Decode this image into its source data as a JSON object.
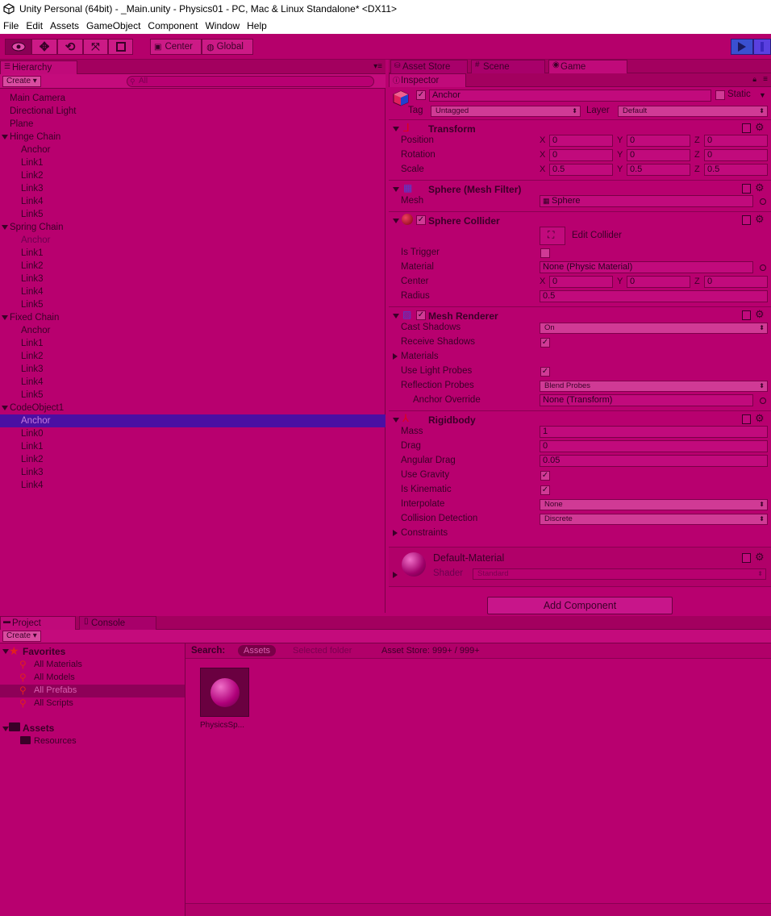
{
  "window_title": "Unity Personal (64bit) - _Main.unity - Physics01 - PC, Mac & Linux Standalone* <DX11>",
  "menu": [
    "File",
    "Edit",
    "Assets",
    "GameObject",
    "Component",
    "Window",
    "Help"
  ],
  "toolbar": {
    "center_label": "Center",
    "global_label": "Global"
  },
  "hierarchy": {
    "tab": "Hierarchy",
    "create": "Create",
    "search_placeholder": "All",
    "items": [
      {
        "label": "Main Camera"
      },
      {
        "label": "Directional Light"
      },
      {
        "label": "Plane"
      },
      {
        "label": "Hinge Chain"
      },
      {
        "label": "Anchor"
      },
      {
        "label": "Link1"
      },
      {
        "label": "Link2"
      },
      {
        "label": "Link3"
      },
      {
        "label": "Link4"
      },
      {
        "label": "Link5"
      },
      {
        "label": "Spring Chain"
      },
      {
        "label": "Anchor"
      },
      {
        "label": "Link1"
      },
      {
        "label": "Link2"
      },
      {
        "label": "Link3"
      },
      {
        "label": "Link4"
      },
      {
        "label": "Link5"
      },
      {
        "label": "Fixed Chain"
      },
      {
        "label": "Anchor"
      },
      {
        "label": "Link1"
      },
      {
        "label": "Link2"
      },
      {
        "label": "Link3"
      },
      {
        "label": "Link4"
      },
      {
        "label": "Link5"
      },
      {
        "label": "CodeObject1"
      },
      {
        "label": "Anchor"
      },
      {
        "label": "Link0"
      },
      {
        "label": "Link1"
      },
      {
        "label": "Link2"
      },
      {
        "label": "Link3"
      },
      {
        "label": "Link4"
      }
    ]
  },
  "top_tabs": {
    "asset_store": "Asset Store",
    "scene": "Scene",
    "game": "Game"
  },
  "inspector": {
    "tab": "Inspector",
    "object_name": "Anchor",
    "static_label": "Static",
    "tag_label": "Tag",
    "tag_value": "Untagged",
    "layer_label": "Layer",
    "layer_value": "Default",
    "transform": {
      "title": "Transform",
      "position_label": "Position",
      "position": [
        "0",
        "0",
        "0"
      ],
      "rotation_label": "Rotation",
      "rotation": [
        "0",
        "0",
        "0"
      ],
      "scale_label": "Scale",
      "scale": [
        "0.5",
        "0.5",
        "0.5"
      ],
      "axes": [
        "X",
        "Y",
        "Z"
      ]
    },
    "mesh_filter": {
      "title": "Sphere (Mesh Filter)",
      "mesh_label": "Mesh",
      "mesh_value": "Sphere"
    },
    "sphere_collider": {
      "title": "Sphere Collider",
      "edit_label": "Edit Collider",
      "is_trigger_label": "Is Trigger",
      "material_label": "Material",
      "material_value": "None (Physic Material)",
      "center_label": "Center",
      "center": [
        "0",
        "0",
        "0"
      ],
      "radius_label": "Radius",
      "radius_value": "0.5"
    },
    "mesh_renderer": {
      "title": "Mesh Renderer",
      "cast_shadows_label": "Cast Shadows",
      "cast_shadows_value": "On",
      "receive_shadows_label": "Receive Shadows",
      "materials_label": "Materials",
      "light_probes_label": "Use Light Probes",
      "reflection_label": "Reflection Probes",
      "reflection_value": "Blend Probes",
      "anchor_override_label": "Anchor Override",
      "anchor_override_value": "None (Transform)"
    },
    "rigidbody": {
      "title": "Rigidbody",
      "mass_label": "Mass",
      "mass_value": "1",
      "drag_label": "Drag",
      "drag_value": "0",
      "angular_drag_label": "Angular Drag",
      "angular_drag_value": "0.05",
      "use_gravity_label": "Use Gravity",
      "is_kinematic_label": "Is Kinematic",
      "interpolate_label": "Interpolate",
      "interpolate_value": "None",
      "collision_label": "Collision Detection",
      "collision_value": "Discrete",
      "constraints_label": "Constraints"
    },
    "material": {
      "name": "Default-Material",
      "shader_label": "Shader",
      "shader_value": "Standard"
    },
    "add_component": "Add Component"
  },
  "project": {
    "tab": "Project",
    "console_tab": "Console",
    "create": "Create",
    "favorites_label": "Favorites",
    "favorites": [
      {
        "label": "All Materials"
      },
      {
        "label": "All Models"
      },
      {
        "label": "All Prefabs"
      },
      {
        "label": "All Scripts"
      }
    ],
    "assets_label": "Assets",
    "resources_label": "Resources",
    "search_label": "Search:",
    "search_scope_assets": "Assets",
    "search_scope_folder": "Selected folder",
    "asset_store_count": "Asset Store: 999+ / 999+",
    "asset_name": "PhysicsSp..."
  },
  "colors": {
    "background": "#b8006f",
    "selection": "#4b0fa3",
    "play_button": "#3a50d0"
  }
}
